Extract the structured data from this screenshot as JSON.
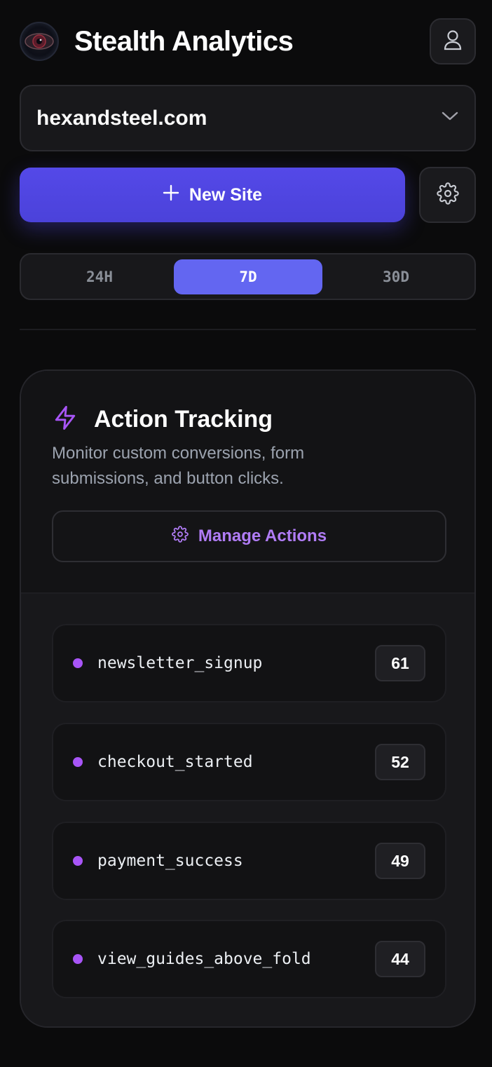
{
  "header": {
    "app_title": "Stealth Analytics",
    "logo_icon": "eye-logo",
    "profile_icon": "user-icon"
  },
  "site_selector": {
    "selected_site": "hexandsteel.com",
    "icon": "chevron-down-icon"
  },
  "actions_bar": {
    "new_site_label": "New Site",
    "new_site_icon": "plus-icon",
    "settings_icon": "gear-icon"
  },
  "range": {
    "options": [
      "24H",
      "7D",
      "30D"
    ],
    "selected": "7D"
  },
  "action_tracking": {
    "title": "Action Tracking",
    "title_icon": "lightning-icon",
    "description": "Monitor custom conversions, form submissions, and button clicks.",
    "manage_label": "Manage Actions",
    "manage_icon": "gear-icon",
    "items": [
      {
        "name": "newsletter_signup",
        "count": "61"
      },
      {
        "name": "checkout_started",
        "count": "52"
      },
      {
        "name": "payment_success",
        "count": "49"
      },
      {
        "name": "view_guides_above_fold",
        "count": "44"
      }
    ]
  },
  "colors": {
    "background": "#0b0b0c",
    "primary": "#4f46e5",
    "segment_active": "#6366f1",
    "accent_purple": "#a855f7"
  }
}
